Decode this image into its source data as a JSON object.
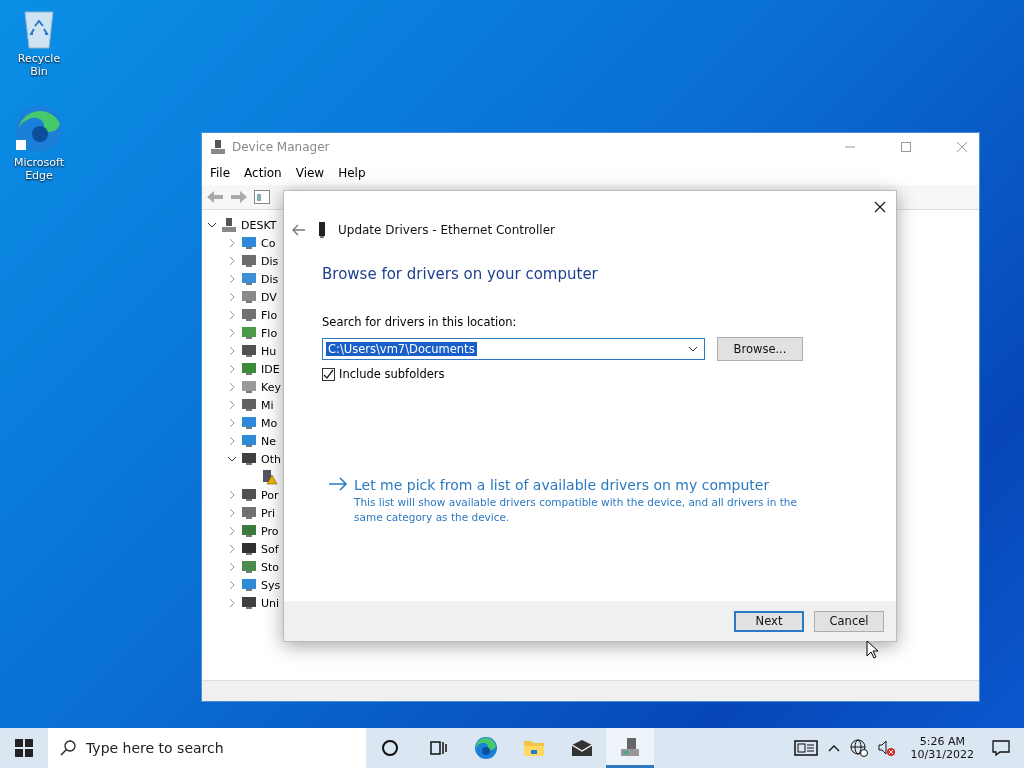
{
  "desktop_icons": [
    {
      "label": "Recycle Bin",
      "kind": "recycle"
    },
    {
      "label": "Microsoft Edge",
      "kind": "edge"
    }
  ],
  "window": {
    "title": "Device Manager",
    "menu": [
      "File",
      "Action",
      "View",
      "Help"
    ],
    "tree": {
      "label": "DESKT",
      "expanded": true,
      "children": [
        {
          "label": "Co",
          "expanded": false,
          "color": "#2e8ad8"
        },
        {
          "label": "Dis",
          "expanded": false,
          "color": "#6d6d6d"
        },
        {
          "label": "Dis",
          "expanded": false,
          "color": "#3a8fd8"
        },
        {
          "label": "DV",
          "expanded": false,
          "color": "#8a8a8a"
        },
        {
          "label": "Flo",
          "expanded": false,
          "color": "#707070"
        },
        {
          "label": "Flo",
          "expanded": false,
          "color": "#4a9a4a"
        },
        {
          "label": "Hu",
          "expanded": false,
          "color": "#505050"
        },
        {
          "label": "IDE",
          "expanded": false,
          "color": "#3a8a3a"
        },
        {
          "label": "Key",
          "expanded": false,
          "color": "#9a9a9a"
        },
        {
          "label": "Mi",
          "expanded": false,
          "color": "#606060"
        },
        {
          "label": "Mo",
          "expanded": false,
          "color": "#2e8ad8"
        },
        {
          "label": "Ne",
          "expanded": false,
          "color": "#2e8ad8"
        },
        {
          "label": "Oth",
          "expanded": true,
          "color": "#404040",
          "children": [
            {
              "kind": "warning"
            }
          ]
        },
        {
          "label": "Por",
          "expanded": false,
          "color": "#505050"
        },
        {
          "label": "Pri",
          "expanded": false,
          "color": "#707070"
        },
        {
          "label": "Pro",
          "expanded": false,
          "color": "#3a7a3a"
        },
        {
          "label": "Sof",
          "expanded": false,
          "color": "#303030"
        },
        {
          "label": "Sto",
          "expanded": false,
          "color": "#4a8a4a"
        },
        {
          "label": "Sys",
          "expanded": false,
          "color": "#2e8ad8"
        },
        {
          "label": "Uni",
          "expanded": false,
          "color": "#404040"
        }
      ]
    }
  },
  "dialog": {
    "title": "Update Drivers - Ethernet Controller",
    "heading": "Browse for drivers on your computer",
    "field_label": "Search for drivers in this location:",
    "path": {
      "value": "C:\\Users\\vm7\\Documents",
      "selected": true
    },
    "browse": "Browse...",
    "include_subfolders": {
      "label": "Include subfolders",
      "checked": true
    },
    "option": {
      "title": "Let me pick from a list of available drivers on my computer",
      "description": "This list will show available drivers compatible with the device, and all drivers in the same category as the device."
    },
    "buttons": [
      {
        "label": "Next",
        "default": true
      },
      {
        "label": "Cancel",
        "default": false
      }
    ]
  },
  "taskbar": {
    "search": {
      "placeholder": "Type here to search"
    },
    "apps": [
      {
        "kind": "cortana",
        "active": false
      },
      {
        "kind": "taskview",
        "active": false
      },
      {
        "kind": "edge",
        "active": false
      },
      {
        "kind": "explorer",
        "active": false
      },
      {
        "kind": "mail",
        "active": false
      },
      {
        "kind": "devmgr",
        "active": true
      }
    ],
    "time": "5:26 AM",
    "date": "10/31/2022"
  }
}
